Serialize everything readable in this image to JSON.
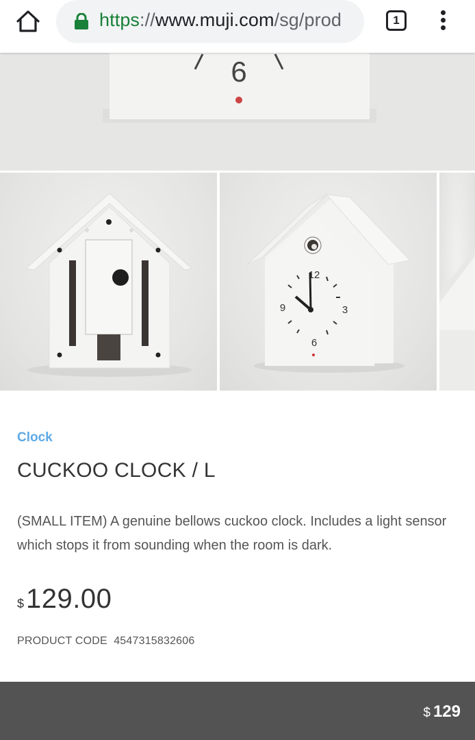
{
  "browser": {
    "url_scheme": "https",
    "url_separator": "://",
    "url_host": "www.muji.com",
    "url_path": "/sg/prod",
    "tab_count": "1"
  },
  "hero": {
    "clock_numeral": "6"
  },
  "thumbnails": {
    "front_clock": {
      "numerals": [
        "12",
        "3",
        "6",
        "9"
      ]
    }
  },
  "product": {
    "category": "Clock",
    "title": "CUCKOO CLOCK / L",
    "description": "(SMALL ITEM) A genuine bellows cuckoo clock. Includes a light sensor which stops it from sounding when the room is dark.",
    "currency": "$",
    "price": "129.00",
    "code_label": "PRODUCT CODE",
    "code_value": "4547315832606"
  },
  "footer_bar": {
    "currency": "$",
    "price": "129"
  },
  "colors": {
    "category_link": "#5ea9e4",
    "secure_green": "#188038",
    "footer_bar": "#535353"
  }
}
